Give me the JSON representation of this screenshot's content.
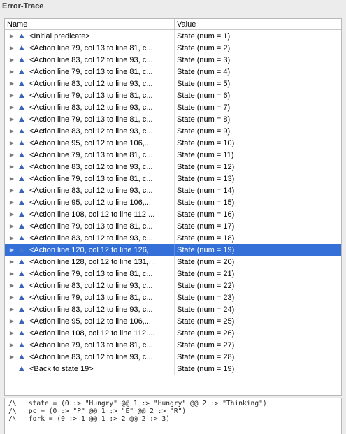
{
  "window": {
    "title": "Error-Trace"
  },
  "table": {
    "columns": {
      "name": "Name",
      "value": "Value"
    },
    "rows": [
      {
        "name": "<Initial predicate>",
        "value": "State (num = 1)",
        "expandable": true,
        "selected": false
      },
      {
        "name": "<Action line 79, col 13 to line 81, c...",
        "value": "State (num = 2)",
        "expandable": true,
        "selected": false
      },
      {
        "name": "<Action line 83, col 12 to line 93, c...",
        "value": "State (num = 3)",
        "expandable": true,
        "selected": false
      },
      {
        "name": "<Action line 79, col 13 to line 81, c...",
        "value": "State (num = 4)",
        "expandable": true,
        "selected": false
      },
      {
        "name": "<Action line 83, col 12 to line 93, c...",
        "value": "State (num = 5)",
        "expandable": true,
        "selected": false
      },
      {
        "name": "<Action line 79, col 13 to line 81, c...",
        "value": "State (num = 6)",
        "expandable": true,
        "selected": false
      },
      {
        "name": "<Action line 83, col 12 to line 93, c...",
        "value": "State (num = 7)",
        "expandable": true,
        "selected": false
      },
      {
        "name": "<Action line 79, col 13 to line 81, c...",
        "value": "State (num = 8)",
        "expandable": true,
        "selected": false
      },
      {
        "name": "<Action line 83, col 12 to line 93, c...",
        "value": "State (num = 9)",
        "expandable": true,
        "selected": false
      },
      {
        "name": "<Action line 95, col 12 to line 106,...",
        "value": "State (num = 10)",
        "expandable": true,
        "selected": false
      },
      {
        "name": "<Action line 79, col 13 to line 81, c...",
        "value": "State (num = 11)",
        "expandable": true,
        "selected": false
      },
      {
        "name": "<Action line 83, col 12 to line 93, c...",
        "value": "State (num = 12)",
        "expandable": true,
        "selected": false
      },
      {
        "name": "<Action line 79, col 13 to line 81, c...",
        "value": "State (num = 13)",
        "expandable": true,
        "selected": false
      },
      {
        "name": "<Action line 83, col 12 to line 93, c...",
        "value": "State (num = 14)",
        "expandable": true,
        "selected": false
      },
      {
        "name": "<Action line 95, col 12 to line 106,...",
        "value": "State (num = 15)",
        "expandable": true,
        "selected": false
      },
      {
        "name": "<Action line 108, col 12 to line 112,...",
        "value": "State (num = 16)",
        "expandable": true,
        "selected": false
      },
      {
        "name": "<Action line 79, col 13 to line 81, c...",
        "value": "State (num = 17)",
        "expandable": true,
        "selected": false
      },
      {
        "name": "<Action line 83, col 12 to line 93, c...",
        "value": "State (num = 18)",
        "expandable": true,
        "selected": false
      },
      {
        "name": "<Action line 120, col 12 to line 126,...",
        "value": "State (num = 19)",
        "expandable": true,
        "selected": true
      },
      {
        "name": "<Action line 128, col 12 to line 131,...",
        "value": "State (num = 20)",
        "expandable": true,
        "selected": false
      },
      {
        "name": "<Action line 79, col 13 to line 81, c...",
        "value": "State (num = 21)",
        "expandable": true,
        "selected": false
      },
      {
        "name": "<Action line 83, col 12 to line 93, c...",
        "value": "State (num = 22)",
        "expandable": true,
        "selected": false
      },
      {
        "name": "<Action line 79, col 13 to line 81, c...",
        "value": "State (num = 23)",
        "expandable": true,
        "selected": false
      },
      {
        "name": "<Action line 83, col 12 to line 93, c...",
        "value": "State (num = 24)",
        "expandable": true,
        "selected": false
      },
      {
        "name": "<Action line 95, col 12 to line 106,...",
        "value": "State (num = 25)",
        "expandable": true,
        "selected": false
      },
      {
        "name": "<Action line 108, col 12 to line 112,...",
        "value": "State (num = 26)",
        "expandable": true,
        "selected": false
      },
      {
        "name": "<Action line 79, col 13 to line 81, c...",
        "value": "State (num = 27)",
        "expandable": true,
        "selected": false
      },
      {
        "name": "<Action line 83, col 12 to line 93, c...",
        "value": "State (num = 28)",
        "expandable": true,
        "selected": false
      },
      {
        "name": "<Back to state 19>",
        "value": "State (num = 19)",
        "expandable": false,
        "selected": false
      }
    ]
  },
  "detail": {
    "lines": [
      "/\\   state = (0 :> \"Hungry\" @@ 1 :> \"Hungry\" @@ 2 :> \"Thinking\")",
      "/\\   pc = (0 :> \"P\" @@ 1 :> \"E\" @@ 2 :> \"R\")",
      "/\\   fork = (0 :> 1 @@ 1 :> 2 @@ 2 :> 3)"
    ]
  },
  "icons": {
    "disclosure": "disclosure-triangle-icon",
    "state": "state-triangle-icon"
  },
  "colors": {
    "selection": "#3470d8",
    "state_icon": "#3a63b8"
  }
}
